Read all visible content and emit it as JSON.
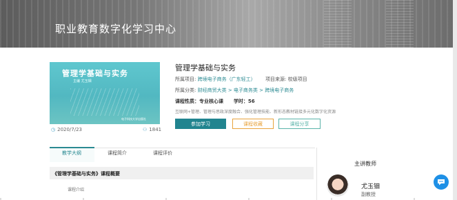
{
  "banner": {
    "title": "职业教育数字化学习中心"
  },
  "course": {
    "title": "管理学基础与实务",
    "cover_title": "管理学基础与实务",
    "cover_subtitle": "主编 尤玉钿",
    "cover_publisher": "电子科技大学出版社",
    "date": "2020/7/23",
    "learner_count": "1841",
    "project_label": "所属项目:",
    "project_value": "跨境电子商务（广东轻工）",
    "source_label": "项目来源:",
    "source_value": "校级项目",
    "category_label": "所属分类:",
    "category_value": "财经商贸大类 > 电子商务类 > 跨境电子商务",
    "nature": "课程性质：专业核心课",
    "hours": "学时：56",
    "tags": "互联网+管理、管理与思政深度融合、强化管理技能、新形态教材链接多元化数字化资源"
  },
  "buttons": {
    "join": "参加学习",
    "favorite": "课程收藏",
    "share": "课程分享"
  },
  "tabs": [
    "教学大纲",
    "课程简介",
    "课程评价"
  ],
  "outline": {
    "section_title": "《管理学基础与实务》课程概要",
    "intro_label": "课程介绍"
  },
  "teacher": {
    "heading": "主讲教师",
    "name": "尤玉钿",
    "title": "副教授"
  },
  "icons": {
    "date": "clock-icon",
    "learners": "users-icon",
    "chat": "chat-icon"
  },
  "colors": {
    "accent": "#21848f",
    "favorite": "#e8a33d",
    "share": "#5ab3a9",
    "chat": "#1e90e6"
  }
}
